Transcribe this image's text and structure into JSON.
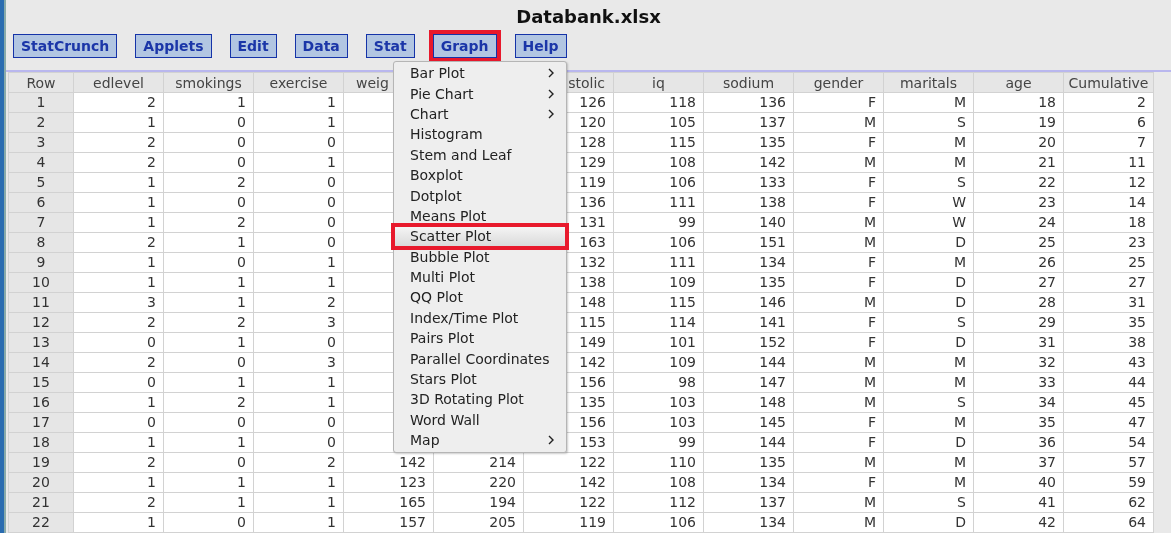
{
  "window": {
    "title": "Databank.xlsx"
  },
  "menu_bar": [
    {
      "label": "StatCrunch",
      "annotated": false
    },
    {
      "label": "Applets",
      "annotated": false
    },
    {
      "label": "Edit",
      "annotated": false
    },
    {
      "label": "Data",
      "annotated": false
    },
    {
      "label": "Stat",
      "annotated": false
    },
    {
      "label": "Graph",
      "annotated": true
    },
    {
      "label": "Help",
      "annotated": false
    }
  ],
  "graph_menu": [
    {
      "label": "Bar Plot",
      "submenu": true,
      "selected": false,
      "annotated": false
    },
    {
      "label": "Pie Chart",
      "submenu": true,
      "selected": false,
      "annotated": false
    },
    {
      "label": "Chart",
      "submenu": true,
      "selected": false,
      "annotated": false
    },
    {
      "label": "Histogram",
      "submenu": false,
      "selected": false,
      "annotated": false
    },
    {
      "label": "Stem and Leaf",
      "submenu": false,
      "selected": false,
      "annotated": false
    },
    {
      "label": "Boxplot",
      "submenu": false,
      "selected": false,
      "annotated": false
    },
    {
      "label": "Dotplot",
      "submenu": false,
      "selected": false,
      "annotated": false
    },
    {
      "label": "Means Plot",
      "submenu": false,
      "selected": false,
      "annotated": false
    },
    {
      "label": "Scatter Plot",
      "submenu": false,
      "selected": true,
      "annotated": true
    },
    {
      "label": "Bubble Plot",
      "submenu": false,
      "selected": false,
      "annotated": false
    },
    {
      "label": "Multi Plot",
      "submenu": false,
      "selected": false,
      "annotated": false
    },
    {
      "label": "QQ Plot",
      "submenu": false,
      "selected": false,
      "annotated": false
    },
    {
      "label": "Index/Time Plot",
      "submenu": false,
      "selected": false,
      "annotated": false
    },
    {
      "label": "Pairs Plot",
      "submenu": false,
      "selected": false,
      "annotated": false
    },
    {
      "label": "Parallel Coordinates",
      "submenu": false,
      "selected": false,
      "annotated": false
    },
    {
      "label": "Stars Plot",
      "submenu": false,
      "selected": false,
      "annotated": false
    },
    {
      "label": "3D Rotating Plot",
      "submenu": false,
      "selected": false,
      "annotated": false
    },
    {
      "label": "Word Wall",
      "submenu": false,
      "selected": false,
      "annotated": false
    },
    {
      "label": "Map",
      "submenu": true,
      "selected": false,
      "annotated": false
    }
  ],
  "table": {
    "columns": [
      "Row",
      "edlevel",
      "smokings",
      "exercise",
      "weig",
      null,
      "stolic",
      "iq",
      "sodium",
      "gender",
      "maritals",
      "age",
      "Cumulative"
    ],
    "rows": [
      [
        "1",
        "2",
        "1",
        "1",
        null,
        null,
        "126",
        "118",
        "136",
        "F",
        "M",
        "18",
        "2"
      ],
      [
        "2",
        "1",
        "0",
        "1",
        null,
        null,
        "120",
        "105",
        "137",
        "M",
        "S",
        "19",
        "6"
      ],
      [
        "3",
        "2",
        "0",
        "0",
        null,
        null,
        "128",
        "115",
        "135",
        "F",
        "M",
        "20",
        "7"
      ],
      [
        "4",
        "2",
        "0",
        "1",
        null,
        null,
        "129",
        "108",
        "142",
        "M",
        "M",
        "21",
        "11"
      ],
      [
        "5",
        "1",
        "2",
        "0",
        null,
        null,
        "119",
        "106",
        "133",
        "F",
        "S",
        "22",
        "12"
      ],
      [
        "6",
        "1",
        "0",
        "0",
        null,
        null,
        "136",
        "111",
        "138",
        "F",
        "W",
        "23",
        "14"
      ],
      [
        "7",
        "1",
        "2",
        "0",
        null,
        null,
        "131",
        "99",
        "140",
        "M",
        "W",
        "24",
        "18"
      ],
      [
        "8",
        "2",
        "1",
        "0",
        null,
        null,
        "163",
        "106",
        "151",
        "M",
        "D",
        "25",
        "23"
      ],
      [
        "9",
        "1",
        "0",
        "1",
        null,
        null,
        "132",
        "111",
        "134",
        "F",
        "M",
        "26",
        "25"
      ],
      [
        "10",
        "1",
        "1",
        "1",
        null,
        null,
        "138",
        "109",
        "135",
        "F",
        "D",
        "27",
        "27"
      ],
      [
        "11",
        "3",
        "1",
        "2",
        null,
        null,
        "148",
        "115",
        "146",
        "M",
        "D",
        "28",
        "31"
      ],
      [
        "12",
        "2",
        "2",
        "3",
        null,
        null,
        "115",
        "114",
        "141",
        "F",
        "S",
        "29",
        "35"
      ],
      [
        "13",
        "0",
        "1",
        "0",
        null,
        null,
        "149",
        "101",
        "152",
        "F",
        "D",
        "31",
        "38"
      ],
      [
        "14",
        "2",
        "0",
        "3",
        null,
        null,
        "142",
        "109",
        "144",
        "M",
        "M",
        "32",
        "43"
      ],
      [
        "15",
        "0",
        "1",
        "1",
        null,
        null,
        "156",
        "98",
        "147",
        "M",
        "M",
        "33",
        "44"
      ],
      [
        "16",
        "1",
        "2",
        "1",
        null,
        null,
        "135",
        "103",
        "148",
        "M",
        "S",
        "34",
        "45"
      ],
      [
        "17",
        "0",
        "0",
        "0",
        null,
        null,
        "156",
        "103",
        "145",
        "F",
        "M",
        "35",
        "47"
      ],
      [
        "18",
        "1",
        "1",
        "0",
        null,
        null,
        "153",
        "99",
        "144",
        "F",
        "D",
        "36",
        "54"
      ],
      [
        "19",
        "2",
        "0",
        "2",
        "142",
        "214",
        "122",
        "110",
        "135",
        "M",
        "M",
        "37",
        "57"
      ],
      [
        "20",
        "1",
        "1",
        "1",
        "123",
        "220",
        "142",
        "108",
        "134",
        "F",
        "M",
        "40",
        "59"
      ],
      [
        "21",
        "2",
        "1",
        "1",
        "165",
        "194",
        "122",
        "112",
        "137",
        "M",
        "S",
        "41",
        "62"
      ],
      [
        "22",
        "1",
        "0",
        "1",
        "157",
        "205",
        "119",
        "106",
        "134",
        "M",
        "D",
        "42",
        "64"
      ]
    ]
  }
}
